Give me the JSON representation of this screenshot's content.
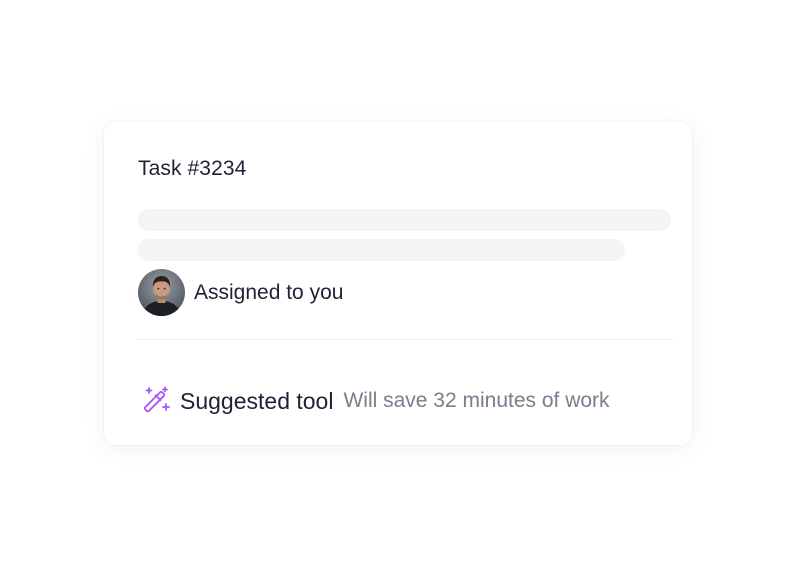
{
  "task": {
    "title": "Task #3234"
  },
  "assignee": {
    "avatar_icon": "person-avatar",
    "label": "Assigned to you"
  },
  "suggestion": {
    "icon": "magic-wand-icon",
    "icon_color": "#a855f7",
    "title": "Suggested tool",
    "note": "Will save 32 minutes of work"
  },
  "colors": {
    "text_primary": "#1e2235",
    "text_secondary": "#7a7d8c",
    "skeleton": "#f4f4f5",
    "accent": "#a855f7"
  }
}
